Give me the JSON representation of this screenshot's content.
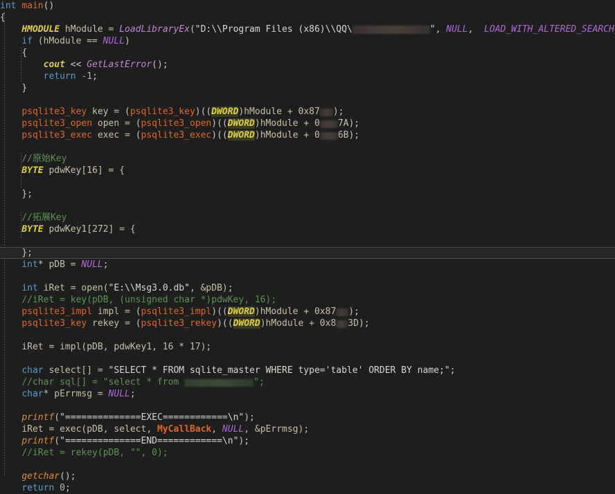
{
  "editor": {
    "language": "cpp",
    "function_name": "main",
    "background_color": "#1e1e1e",
    "current_line_index": 18,
    "colors": {
      "keyword": "#5a9ad6",
      "type": "#e0d040",
      "function": "#c586d8",
      "function_orange": "#e08b3c",
      "macro": "#b06ad8",
      "identifier": "#e0672a",
      "string": "#d8d8d0",
      "comment": "#5e9455",
      "variable": "#c8c0a8",
      "current_line_bg": "#262626"
    }
  },
  "code": {
    "l0": {
      "kw": "int",
      "fn": "main",
      "rest": "()"
    },
    "l1": {
      "text": "{"
    },
    "l2": {
      "type": "HMODULE",
      "var": " hModule = ",
      "fn": "LoadLibraryEx",
      "p1": "(",
      "str": "\"D:\\\\Program Files (x86)\\\\QQ\\",
      "str2": "\"",
      "c1": ", ",
      "m1": "NULL",
      "c2": ",  ",
      "m2": "LOAD_WITH_ALTERED_SEARCH_PATH",
      "end": ");"
    },
    "l3": {
      "kw": "if",
      "mid": " (hModule == ",
      "macro": "NULL",
      "end": ")"
    },
    "l4": {
      "text": "{"
    },
    "l5": {
      "obj": "cout",
      "op": " << ",
      "fn": "GetLastError",
      "end": "();"
    },
    "l6": {
      "kw": "return",
      "num": " -1",
      "end": ";"
    },
    "l7": {
      "text": "}"
    },
    "l8": {
      "text": ""
    },
    "l9": {
      "ident": "psqlite3_key",
      "var": " key = ",
      "p": "(",
      "ident2": "psqlite3_key",
      "p2": ")((",
      "type": "DWORD",
      "p3": ")hModule + 0x87",
      "end": ");"
    },
    "l10": {
      "ident": "psqlite3_open",
      "var": " open = ",
      "p": "(",
      "ident2": "psqlite3_open",
      "p2": ")((",
      "type": "DWORD",
      "p3": ")hModule + 0",
      "tail": "7A",
      "end": ");"
    },
    "l11": {
      "ident": "psqlite3_exec",
      "var": " exec = ",
      "p": "(",
      "ident2": "psqlite3_exec",
      "p2": ")((",
      "type": "DWORD",
      "p3": ")hModule + 0",
      "tail": "6B",
      "end": ");"
    },
    "l12": {
      "text": ""
    },
    "l13": {
      "comment": "//原始Key"
    },
    "l14": {
      "type": "BYTE",
      "rest": " pdwKey[16] = {"
    },
    "l15": {
      "text": ""
    },
    "l16": {
      "text": "};"
    },
    "l17": {
      "text": ""
    },
    "l18": {
      "comment": "//拓展Key"
    },
    "l19": {
      "type": "BYTE",
      "rest": " pdwKey1[272] = {"
    },
    "l20": {
      "text": ""
    },
    "l21": {
      "text": "};"
    },
    "l22": {
      "kw": "int",
      "star": "* pDB = ",
      "macro": "NULL",
      "end": ";"
    },
    "l23": {
      "text": ""
    },
    "l24": {
      "kw": "int",
      "var": " iRet = open(",
      "str": "\"E:\\\\Msg3.0.db\"",
      "rest": ", &pDB);"
    },
    "l25": {
      "comment": "//iRet = key(pDB, (unsigned char *)pdwKey, 16);"
    },
    "l26": {
      "ident": "psqlite3_impl",
      "var": " impl = ",
      "p": "(",
      "ident2": "psqlite3_impl",
      "p2": ")((",
      "type": "DWORD",
      "p3": ")hModule + 0x87",
      "end": ");"
    },
    "l27": {
      "ident": "psqlite3_key",
      "var": " rekey = ",
      "p": "(",
      "ident2": "psqlite3_rekey",
      "p2": ")((",
      "type": "DWORD",
      "p3": ")hModule + 0x8",
      "tail": "3D",
      "end": ");"
    },
    "l28": {
      "text": ""
    },
    "l29": {
      "var": "iRet = impl(pDB, pdwKey1, 16 * 17);"
    },
    "l30": {
      "text": ""
    },
    "l31": {
      "kw": "char",
      "var": " select[] = ",
      "str": "\"SELECT * FROM sqlite_master WHERE type='table' ORDER BY name;\"",
      "end": ";"
    },
    "l32": {
      "comment": "//char sql[] = \"select * from ",
      "comment_end": "\";"
    },
    "l33": {
      "kw": "char",
      "star": "* pErrmsg = ",
      "macro": "NULL",
      "end": ";"
    },
    "l34": {
      "text": ""
    },
    "l35": {
      "fn": "printf",
      "p": "(",
      "str": "\"==============EXEC============\\n\"",
      "end": ");"
    },
    "l36": {
      "var": "iRet = exec(pDB, select, ",
      "identb": "MyCallBack",
      "c1": ", ",
      "macro": "NULL",
      "c2": ", &pErrmsg);"
    },
    "l37": {
      "fn": "printf",
      "p": "(",
      "str": "\"==============END============\\n\"",
      "end": ");"
    },
    "l38": {
      "comment": "//iRet = rekey(pDB, \"\", 0);"
    },
    "l39": {
      "text": ""
    },
    "l40": {
      "fn": "getchar",
      "end": "();"
    },
    "l41": {
      "kw": "return",
      "num": " 0",
      "end": ";"
    }
  },
  "redactions": {
    "path_redaction_label": "blurred-folder-name",
    "hex_redaction_label": "blurred-hex-offset",
    "sql_redaction_label": "blurred-table-name"
  }
}
